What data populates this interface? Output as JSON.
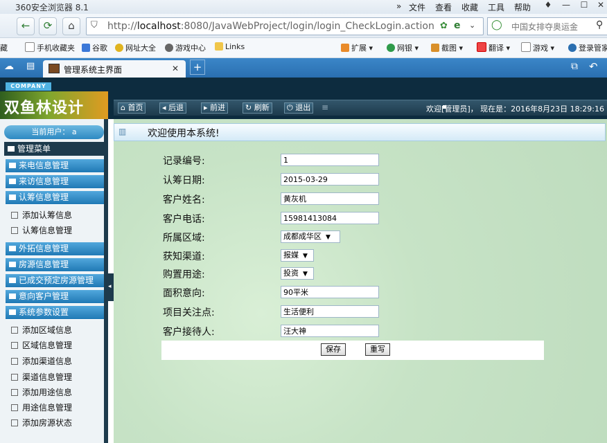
{
  "browser": {
    "app_title": "360安全浏览器 8.1",
    "menus": [
      "文件",
      "查看",
      "收藏",
      "工具",
      "帮助"
    ],
    "url_prefix": "http://",
    "url_host": "localhost",
    "url_rest": ":8080/JavaWebProject/login/login_CheckLogin.action",
    "search_placeholder": "中国女排夺奥运金",
    "bookmarks": [
      "藏",
      "手机收藏夹",
      "谷歌",
      "网址大全",
      "游戏中心",
      "Links",
      "扩展",
      "网银",
      "截图",
      "翻译",
      "游戏",
      "登录管家"
    ],
    "tab_title": "管理系统主界面"
  },
  "header": {
    "company": "COMPANY",
    "logo_text": "双鱼林设计",
    "toolbar": [
      "首页",
      "后退",
      "前进",
      "刷新",
      "退出"
    ],
    "welcome": "欢迎[管理员]，  现在是：2016年8月23日  18:29:16"
  },
  "sidebar": {
    "current_user": "当前用户： a",
    "title": "管理菜单",
    "sections": [
      {
        "label": "来电信息管理"
      },
      {
        "label": "来访信息管理"
      },
      {
        "label": "认筹信息管理",
        "items": [
          "添加认筹信息",
          "认筹信息管理"
        ]
      },
      {
        "label": "外拓信息管理"
      },
      {
        "label": "房源信息管理"
      },
      {
        "label": "已成交预定房源管理"
      },
      {
        "label": "意向客户管理"
      },
      {
        "label": "系统参数设置",
        "items": [
          "添加区域信息",
          "区域信息管理",
          "添加渠道信息",
          "渠道信息管理",
          "添加用途信息",
          "用途信息管理",
          "添加房源状态"
        ]
      }
    ]
  },
  "content": {
    "heading": "欢迎使用本系统!",
    "fields": [
      {
        "label": "记录编号:",
        "value": "1",
        "type": "text"
      },
      {
        "label": "认筹日期:",
        "value": "2015-03-29",
        "type": "text"
      },
      {
        "label": "客户姓名:",
        "value": "黄灰机",
        "type": "text"
      },
      {
        "label": "客户电话:",
        "value": "15981413084",
        "type": "text"
      },
      {
        "label": "所属区域:",
        "value": "成都成华区",
        "type": "select"
      },
      {
        "label": "获知渠道:",
        "value": "报媒",
        "type": "select"
      },
      {
        "label": "购置用途:",
        "value": "投资",
        "type": "select"
      },
      {
        "label": "面积意向:",
        "value": "90平米",
        "type": "text"
      },
      {
        "label": "项目关注点:",
        "value": "生活便利",
        "type": "text"
      },
      {
        "label": "客户接待人:",
        "value": "汪大神",
        "type": "text"
      }
    ],
    "save_label": "保存",
    "reset_label": "重写"
  }
}
